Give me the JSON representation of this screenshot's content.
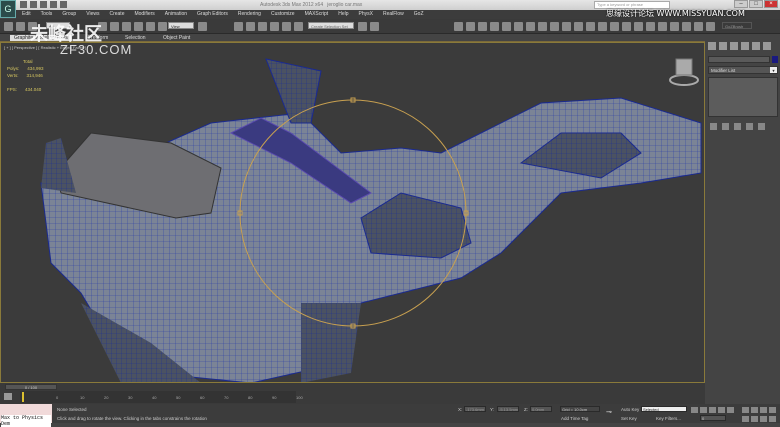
{
  "title": {
    "app": "Autodesk 3ds Max 2012 x64",
    "file": "jeroglio car.max",
    "search_placeholder": "Type a keyword or phrase"
  },
  "menu": [
    "Edit",
    "Tools",
    "Group",
    "Views",
    "Create",
    "Modifiers",
    "Animation",
    "Graph Editors",
    "Rendering",
    "Customize",
    "MAXScript",
    "Help",
    "PhysX",
    "RealFlow",
    "GoZ"
  ],
  "toolbar": {
    "selection_filter": "All",
    "ref_coord": "View",
    "named_sel": "Create Selection Set",
    "goz": "GoZBrush"
  },
  "ribbon": {
    "tabs": [
      "Graphite Modeling Tools",
      "Freeform",
      "Selection",
      "Object Paint"
    ]
  },
  "viewport": {
    "label": "[ + ] [ Perspective ] [ Realistic + Edged Faces ]",
    "stats": {
      "header": "Total",
      "polys_label": "Polys:",
      "polys": "434,993",
      "verts_label": "Verts:",
      "verts": "314,946",
      "fps_label": "FPS:",
      "fps": "434.040"
    }
  },
  "watermarks": {
    "left_cn": "未峰社区",
    "left_en": "ZF30.COM",
    "right": "思缘设计论坛 WWW.MISSYUAN.COM"
  },
  "command_panel": {
    "modifier_list": "Modifier List"
  },
  "timeline": {
    "frame": "0 / 100",
    "ticks": [
      "0",
      "10",
      "20",
      "30",
      "40",
      "50",
      "60",
      "70",
      "80",
      "90",
      "100"
    ]
  },
  "status": {
    "maxscript": "Max to Physics Dem",
    "selection": "None Selected",
    "prompt": "Click and drag to rotate the view.  Clicking in the tabs constrains the rotation",
    "x_label": "X:",
    "x": "-173.6mm",
    "y_label": "Y:",
    "y": "-5.13.5mm",
    "z_label": "Z:",
    "z": "0.0mm",
    "grid": "Grid = 10.0cm",
    "add_time_tag": "Add Time Tag",
    "auto_key": "Auto Key",
    "set_key": "Set Key",
    "key_mode": "Selected",
    "key_filters": "Key Filters...",
    "frame_field": "0"
  }
}
